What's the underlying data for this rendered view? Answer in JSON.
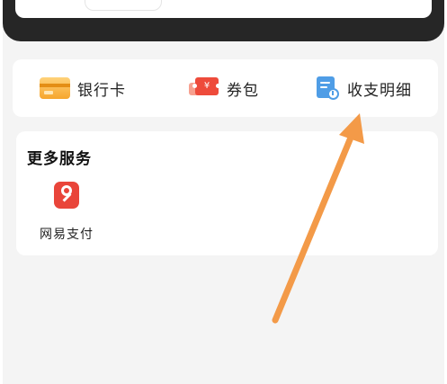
{
  "wallet": {
    "items": [
      {
        "label": "银行卡",
        "icon": "bank-card-icon"
      },
      {
        "label": "券包",
        "icon": "coupon-icon",
        "icon_glyph": "¥"
      },
      {
        "label": "收支明细",
        "icon": "bill-detail-icon"
      }
    ]
  },
  "services": {
    "title": "更多服务",
    "items": [
      {
        "label": "网易支付",
        "icon": "netease-pay-icon"
      }
    ]
  },
  "colors": {
    "page_background": "#f4f4f4",
    "card_background": "#ffffff",
    "top_band": "#262626",
    "annotation_arrow": "#f39a48",
    "bank_icon": "#f6a52d",
    "coupon_icon": "#ee4b3b",
    "bill_icon": "#4f9de6",
    "netease_pay_icon": "#e9453a"
  }
}
